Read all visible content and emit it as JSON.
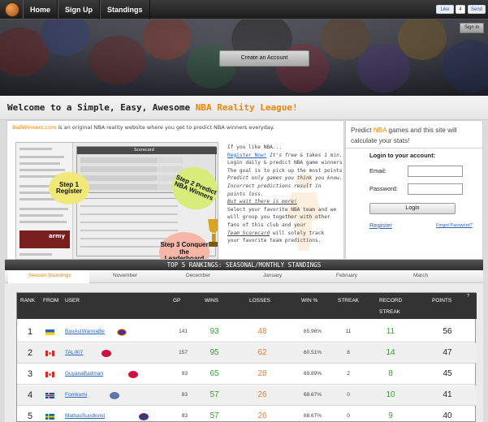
{
  "nav": {
    "home": "Home",
    "signup": "Sign Up",
    "standings": "Standings"
  },
  "social": {
    "like": "Like",
    "like_count": "4",
    "send": "Send"
  },
  "banner": {
    "signin": "Sign in",
    "create_account": "Create an Account"
  },
  "welcome": {
    "prefix": "Welcome to a Simple, Easy, Awesome ",
    "highlight": "NBA Reality League!"
  },
  "intro": {
    "site": "BallWinners.com",
    "text": " is an original NBA reality website where you get to predict NBA winners everyday."
  },
  "screenshot": {
    "step1": "Step 1 Register",
    "step2": "Step 2 Predict NBA Winners",
    "step3": "Step 3 Conquer the Leaderboard",
    "scorecard": "Scorecard",
    "army": "army"
  },
  "pitch": {
    "l1": "If you like NBA...",
    "l2_link": "Register Now!",
    "l2_rest": " It's free & takes 1 min.",
    "l3": "Login daily & predict NBA game winners",
    "l4": "The goal is to pick up the most points",
    "l5": "Predict only games you think you know.",
    "l6": "Incorrect predictions result in",
    "l7": "points loss.",
    "l8": "But wait there is more!",
    "l9": "Select your favorite NBA team and we",
    "l10": "will group you together with other",
    "l11": "fans of this club and your",
    "l12_link": "Team Scorecard",
    "l12_rest": " will solely track",
    "l13": "your favorite team predictions."
  },
  "login": {
    "predict_a": "Predict ",
    "predict_hl": "NBA",
    "predict_b": " games and this site will calculate your stats!",
    "title": "Login to your account:",
    "email_label": "Email:",
    "password_label": "Password:",
    "login_button": "Login",
    "register": "Register",
    "forgot": "Forgot Password?"
  },
  "rankings": {
    "title": "TOP 5 RANKINGS: SEASONAL/MONTHLY STANDINGS",
    "tabs": [
      "Season Standings",
      "November",
      "December",
      "January",
      "February",
      "March"
    ],
    "headers": {
      "rank": "RANK",
      "from": "FROM",
      "user": "USER",
      "gp": "GP",
      "wins": "WINS",
      "losses": "LOSSES",
      "winpct": "WIN %",
      "streak": "STREAK",
      "record": "RECORD",
      "record2": "STREAK",
      "points": "POINTS",
      "help": "?"
    },
    "rows": [
      {
        "rank": "1",
        "user": "BasAsIWannaBe",
        "gp": "141",
        "wins": "93",
        "losses": "48",
        "pct": "65.96%",
        "streak": "11",
        "record_streak": "11",
        "points": "56"
      },
      {
        "rank": "2",
        "user": "TAL007",
        "gp": "157",
        "wins": "95",
        "losses": "62",
        "pct": "60.51%",
        "streak": "8",
        "record_streak": "14",
        "points": "47"
      },
      {
        "rank": "3",
        "user": "GuyanaBadman",
        "gp": "93",
        "wins": "65",
        "losses": "28",
        "pct": "69.89%",
        "streak": "2",
        "record_streak": "8",
        "points": "45"
      },
      {
        "rank": "4",
        "user": "Fornkumi",
        "gp": "83",
        "wins": "57",
        "losses": "26",
        "pct": "68.67%",
        "streak": "0",
        "record_streak": "10",
        "points": "41"
      },
      {
        "rank": "5",
        "user": "MattiasSundkvist",
        "gp": "83",
        "wins": "57",
        "losses": "26",
        "pct": "68.67%",
        "streak": "0",
        "record_streak": "9",
        "points": "40"
      }
    ]
  },
  "colors": {
    "accent": "#e9860e",
    "link": "#2b64b8",
    "win": "#3aa03a",
    "loss": "#e0813a"
  }
}
